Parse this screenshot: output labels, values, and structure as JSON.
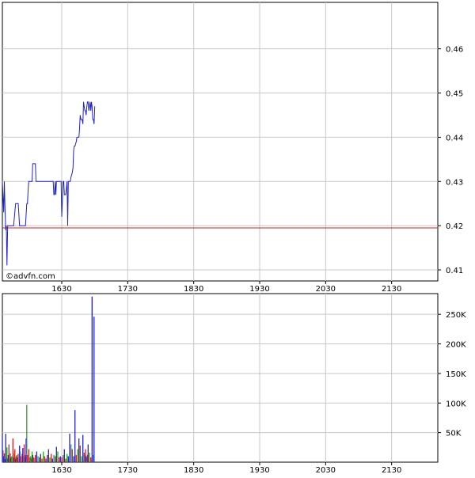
{
  "watermark": "©advfn.com",
  "colors": {
    "price_line": "#2222cc",
    "reference_line": "#cc2222",
    "grid": "#c8c8c8",
    "frame": "#000000",
    "up_volume": "#22aa22",
    "down_volume": "#cc2222",
    "flat_volume": "#2222cc"
  },
  "chart_data": [
    {
      "type": "line",
      "title": "",
      "xlabel": "",
      "ylabel": "",
      "x_ticks": [
        "1630",
        "1730",
        "1830",
        "1930",
        "2030",
        "2130"
      ],
      "y_ticks": [
        "0.41",
        "0.42",
        "0.43",
        "0.44",
        "0.45",
        "0.46"
      ],
      "xlim_minutes": [
        1540,
        2200
      ],
      "ylim": [
        0.4075,
        0.4705
      ],
      "reference_line": 0.4195,
      "series": [
        {
          "x_minutes": [
            1540,
            1542,
            1543,
            1544,
            1545,
            1546,
            1547,
            1548,
            1549,
            1552,
            1554,
            1556,
            1557,
            1560,
            1562,
            1563,
            1564,
            1566,
            1567,
            1570,
            1575,
            1577,
            1578,
            1579,
            1580,
            1583,
            1585,
            1586,
            1587,
            1588,
            1590,
            1591,
            1592,
            1594,
            1595,
            1596,
            1597,
            1598,
            1600,
            1602,
            1604,
            1605,
            1606,
            1607,
            1608,
            1609,
            1610,
            1612,
            1614,
            1616,
            1617,
            1618,
            1619,
            1620,
            1621,
            1622,
            1624,
            1626,
            1628,
            1629,
            1630,
            1632,
            1633,
            1634,
            1636,
            1638,
            1639,
            1640,
            1642,
            1643,
            1644,
            1646,
            1647,
            1648,
            1649,
            1650,
            1652,
            1653,
            1654,
            1655,
            1656,
            1657,
            1658,
            1659,
            1660,
            1661,
            1662,
            1663,
            1664,
            1665,
            1666,
            1667,
            1668,
            1669,
            1670,
            1671,
            1672,
            1673,
            1674,
            1675,
            1676,
            1677,
            1678,
            1679,
            1680
          ],
          "values": [
            0.43,
            0.423,
            0.43,
            0.424,
            0.419,
            0.42,
            0.411,
            0.42,
            0.42,
            0.42,
            0.42,
            0.42,
            0.42,
            0.425,
            0.425,
            0.425,
            0.425,
            0.42,
            0.42,
            0.42,
            0.42,
            0.425,
            0.425,
            0.428,
            0.43,
            0.43,
            0.43,
            0.434,
            0.434,
            0.434,
            0.434,
            0.43,
            0.43,
            0.43,
            0.43,
            0.43,
            0.43,
            0.43,
            0.43,
            0.43,
            0.43,
            0.43,
            0.43,
            0.43,
            0.43,
            0.43,
            0.43,
            0.43,
            0.43,
            0.43,
            0.43,
            0.427,
            0.427,
            0.43,
            0.427,
            0.43,
            0.43,
            0.43,
            0.43,
            0.43,
            0.422,
            0.43,
            0.43,
            0.427,
            0.427,
            0.43,
            0.42,
            0.43,
            0.43,
            0.43,
            0.431,
            0.432,
            0.433,
            0.437,
            0.438,
            0.438,
            0.439,
            0.44,
            0.44,
            0.44,
            0.44,
            0.442,
            0.445,
            0.444,
            0.444,
            0.444,
            0.443,
            0.448,
            0.447,
            0.446,
            0.446,
            0.445,
            0.447,
            0.448,
            0.448,
            0.446,
            0.447,
            0.448,
            0.446,
            0.448,
            0.447,
            0.444,
            0.444,
            0.443,
            0.447
          ]
        }
      ]
    },
    {
      "type": "bar",
      "title": "",
      "xlabel": "",
      "ylabel": "",
      "x_ticks": [
        "1630",
        "1730",
        "1830",
        "1930",
        "2030",
        "2130"
      ],
      "y_ticks": [
        "50K",
        "100K",
        "150K",
        "200K",
        "250K"
      ],
      "xlim_minutes": [
        1540,
        2200
      ],
      "ylim": [
        0,
        285000
      ],
      "series": [
        {
          "name_color_key": "volume",
          "x_minutes": [
            1540,
            1541,
            1542,
            1543,
            1544,
            1545,
            1546,
            1547,
            1548,
            1549,
            1550,
            1551,
            1552,
            1553,
            1554,
            1556,
            1557,
            1558,
            1559,
            1560,
            1561,
            1562,
            1563,
            1564,
            1566,
            1567,
            1568,
            1570,
            1571,
            1572,
            1573,
            1574,
            1575,
            1576,
            1577,
            1578,
            1580,
            1582,
            1583,
            1584,
            1585,
            1586,
            1587,
            1589,
            1590,
            1592,
            1594,
            1596,
            1598,
            1600,
            1602,
            1604,
            1606,
            1608,
            1610,
            1612,
            1614,
            1616,
            1618,
            1620,
            1622,
            1624,
            1626,
            1628,
            1630,
            1632,
            1634,
            1636,
            1638,
            1640,
            1642,
            1644,
            1646,
            1648,
            1650,
            1652,
            1654,
            1656,
            1658,
            1660,
            1662,
            1664,
            1665,
            1666,
            1667,
            1668,
            1669,
            1670,
            1672,
            1674,
            1676,
            1678,
            1679
          ],
          "values": [
            40000,
            20000,
            10000,
            15000,
            5000,
            48000,
            8000,
            25000,
            6000,
            12000,
            30000,
            5000,
            15000,
            8000,
            10000,
            40000,
            8000,
            15000,
            22000,
            6000,
            10000,
            12000,
            8000,
            14000,
            28000,
            18000,
            10000,
            14000,
            24000,
            10000,
            30000,
            8000,
            12000,
            40000,
            97000,
            12000,
            22000,
            8000,
            10000,
            6000,
            18000,
            12000,
            8000,
            7000,
            12000,
            18000,
            10000,
            8000,
            14000,
            6000,
            18000,
            10000,
            6000,
            12000,
            22000,
            8000,
            14000,
            6000,
            12000,
            10000,
            26000,
            18000,
            8000,
            10000,
            8000,
            12000,
            22000,
            6000,
            14000,
            10000,
            48000,
            30000,
            22000,
            10000,
            88000,
            12000,
            22000,
            40000,
            28000,
            10000,
            46000,
            16000,
            12000,
            22000,
            10000,
            8000,
            12000,
            30000,
            16000,
            8000,
            280000,
            12000,
            246000
          ],
          "colors": [
            "blue",
            "red",
            "blue",
            "red",
            "blue",
            "blue",
            "red",
            "green",
            "red",
            "blue",
            "red",
            "green",
            "red",
            "blue",
            "green",
            "red",
            "blue",
            "green",
            "red",
            "blue",
            "red",
            "green",
            "blue",
            "red",
            "blue",
            "green",
            "red",
            "red",
            "blue",
            "green",
            "red",
            "green",
            "blue",
            "blue",
            "green",
            "red",
            "red",
            "blue",
            "green",
            "red",
            "green",
            "blue",
            "red",
            "green",
            "red",
            "blue",
            "green",
            "red",
            "blue",
            "red",
            "green",
            "red",
            "blue",
            "red",
            "blue",
            "green",
            "red",
            "blue",
            "green",
            "red",
            "blue",
            "green",
            "red",
            "blue",
            "red",
            "green",
            "blue",
            "red",
            "green",
            "blue",
            "blue",
            "green",
            "red",
            "blue",
            "blue",
            "red",
            "green",
            "blue",
            "red",
            "green",
            "blue",
            "red",
            "green",
            "red",
            "blue",
            "green",
            "red",
            "blue",
            "green",
            "red",
            "blue",
            "green",
            "blue"
          ]
        }
      ]
    }
  ]
}
